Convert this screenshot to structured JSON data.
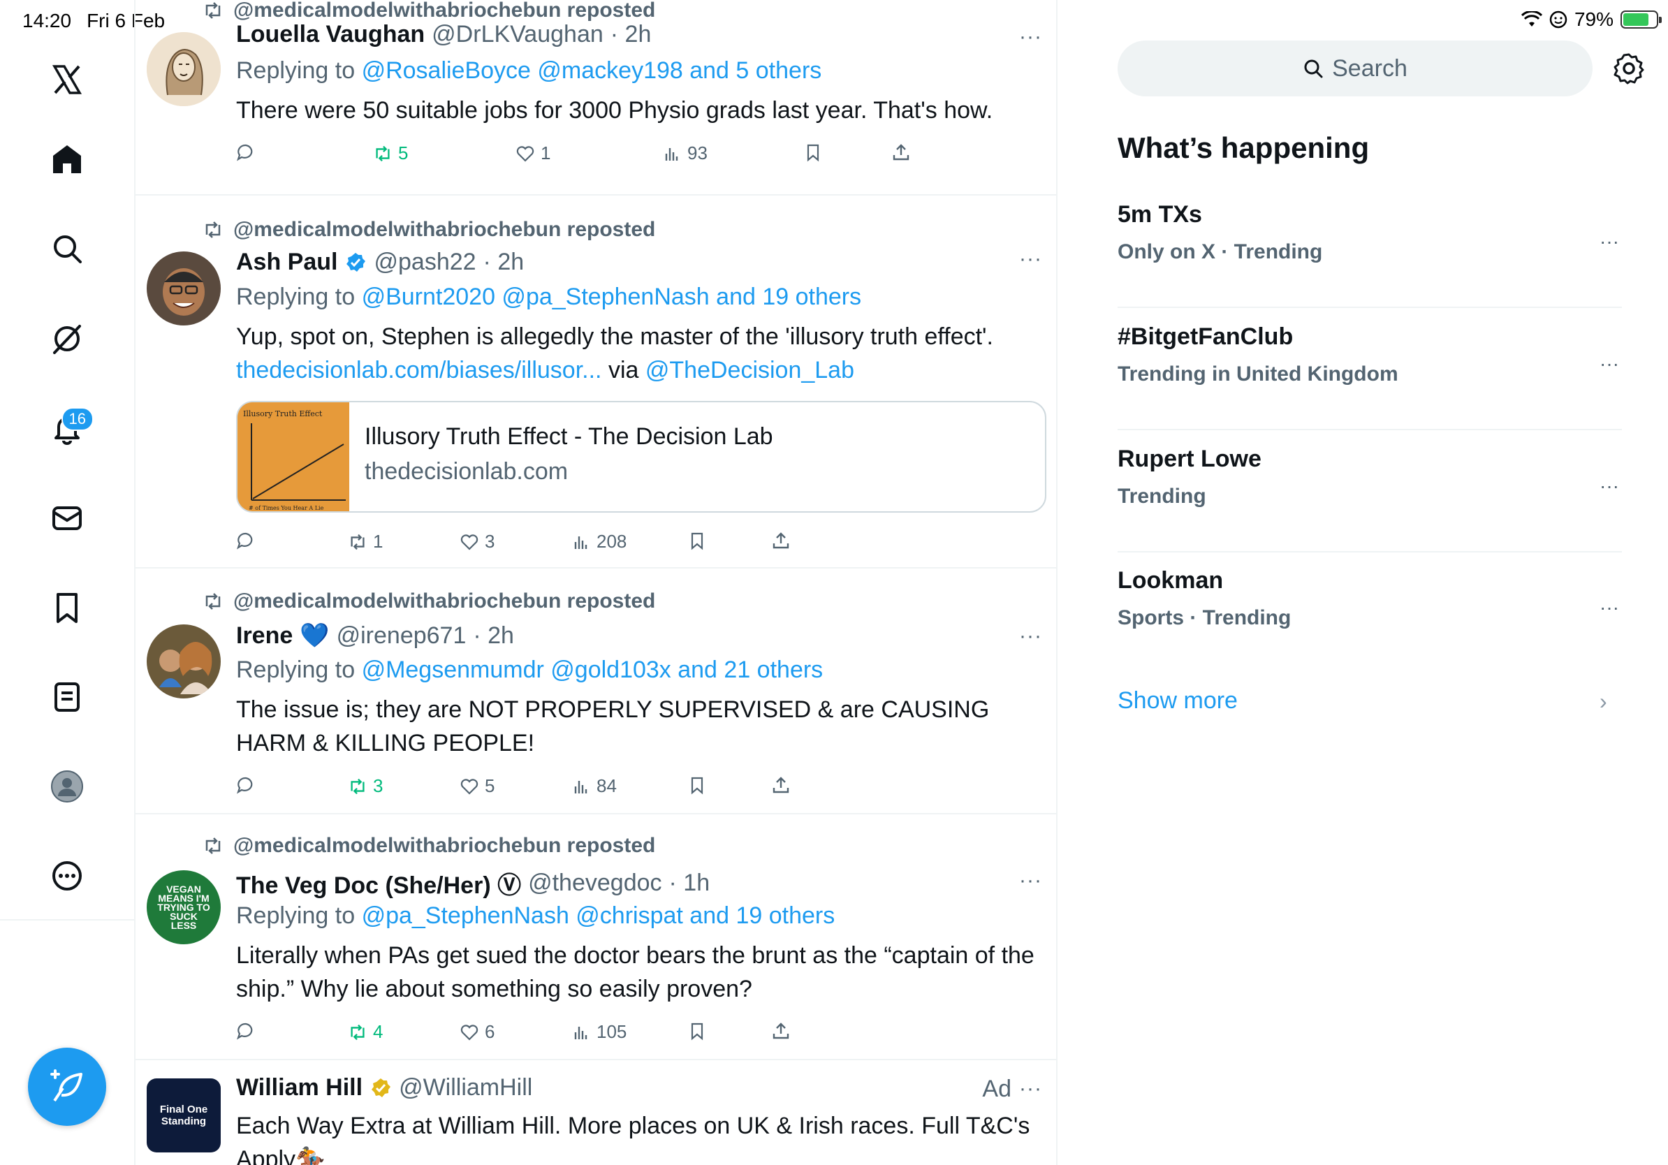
{
  "status_bar": {
    "time": "14:20",
    "date": "Fri 6 Feb",
    "battery": "79%",
    "battery_level": 0.79
  },
  "nav": {
    "notifications_badge": "16",
    "icons": [
      "x-logo-icon",
      "home-icon",
      "search-icon",
      "grok-icon",
      "notifications-icon",
      "messages-icon",
      "bookmarks-icon",
      "lists-icon",
      "profile-icon",
      "more-icon",
      "compose-icon"
    ]
  },
  "tweets": [
    {
      "repost_by": "@medicalmodelwithabriochebun reposted",
      "name": "Louella Vaughan",
      "handle": "@DrLKVaughan",
      "time": "· 2h",
      "reply_prefix": "Replying to",
      "reply_to": "@RosalieBoyce @mackey198 and 5 others",
      "text": "There were 50 suitable jobs for 3000 Physio grads last year. That's how.",
      "reposts": "5",
      "likes": "1",
      "views": "93"
    },
    {
      "repost_by": "@medicalmodelwithabriochebun reposted",
      "name": "Ash Paul",
      "handle": "@pash22",
      "time": "· 2h",
      "reply_prefix": "Replying to",
      "reply_to": "@Burnt2020 @pa_StephenNash and 19 others",
      "text": "Yup, spot on, Stephen is allegedly the master of the 'illusory truth effect'.",
      "link": "thedecisionlab.com/biases/illusor...",
      "via": "via",
      "via_handle": "@TheDecision_Lab",
      "card": {
        "title": "Illusory Truth Effect - The Decision Lab",
        "domain": "thedecisionlab.com",
        "thumb_title": "Illusory Truth Effect",
        "thumb_caption": "# of Times You Hear A Lie"
      },
      "reposts": "1",
      "likes": "3",
      "views": "208"
    },
    {
      "repost_by": "@medicalmodelwithabriochebun reposted",
      "name": "Irene",
      "name_emoji": "💙",
      "handle": "@irenep671",
      "time": "· 2h",
      "reply_prefix": "Replying to",
      "reply_to": "@Megsenmumdr @gold103x and 21 others",
      "text": "The issue is; they are NOT PROPERLY SUPERVISED & are CAUSING HARM & KILLING PEOPLE!",
      "reposts": "3",
      "likes": "5",
      "views": "84"
    },
    {
      "repost_by": "@medicalmodelwithabriochebun reposted",
      "name": "The Veg Doc (She/Her) Ⓥ",
      "handle": "@thevegdoc",
      "time": "· 1h",
      "reply_prefix": "Replying to",
      "reply_to": "@pa_StephenNash @chrispat and 19 others",
      "text": "Literally when PAs get sued the doctor bears the brunt as the “captain of the ship.” Why lie about something so easily proven?",
      "avatar_text": "VEGAN MEANS I'M TRYING TO SUCK LESS",
      "reposts": "4",
      "likes": "6",
      "views": "105"
    },
    {
      "name": "William Hill",
      "handle": "@WilliamHill",
      "ad_label": "Ad",
      "text": "Each Way Extra at William Hill. More places on UK & Irish races. Full T&C's Apply🏇",
      "avatar_text": "Final One Standing"
    }
  ],
  "sidebar": {
    "search_placeholder": "Search",
    "title": "What’s happening",
    "trends": [
      {
        "name": "5m TXs",
        "meta": "Only on X · Trending"
      },
      {
        "name": "#BitgetFanClub",
        "meta": "Trending in United Kingdom"
      },
      {
        "name": "Rupert Lowe",
        "meta": "Trending"
      },
      {
        "name": "Lookman",
        "meta": "Sports · Trending"
      }
    ],
    "show_more": "Show more"
  },
  "colors": {
    "accent": "#1d9bf0",
    "repost_green": "#00ba7c",
    "secondary_text": "#536471",
    "gold_verified": "#e2b719"
  }
}
